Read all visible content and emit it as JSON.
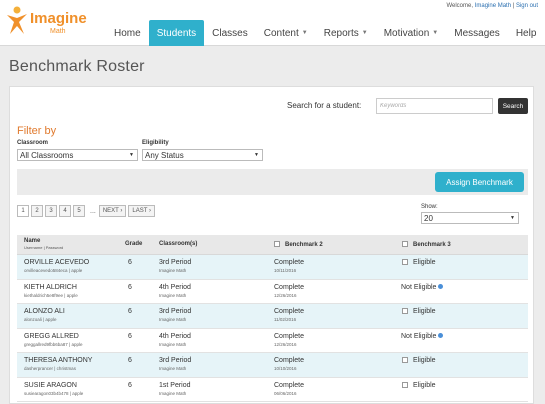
{
  "brand": {
    "name": "Imagine",
    "sub": "Math"
  },
  "top_links": {
    "welcome": "Welcome,",
    "user": "Imagine Math",
    "separator": "|",
    "signout": "Sign out"
  },
  "nav": [
    "Home",
    "Students",
    "Classes",
    "Content",
    "Reports",
    "Motivation",
    "Messages",
    "Help"
  ],
  "nav_active": "Students",
  "page_title": "Benchmark Roster",
  "search": {
    "label": "Search for a student:",
    "placeholder": "Keywords",
    "button": "Search"
  },
  "filter": {
    "title": "Filter by",
    "classroom_label": "Classroom",
    "classroom_value": "All Classrooms",
    "eligibility_label": "Eligibility",
    "eligibility_value": "Any Status"
  },
  "assign_button": "Assign Benchmark",
  "pagination": {
    "pages": [
      "1",
      "2",
      "3",
      "4",
      "5"
    ],
    "ellipsis": "...",
    "next": "NEXT ›",
    "last": "LAST ›"
  },
  "show": {
    "label": "Show:",
    "value": "20"
  },
  "table": {
    "headers": {
      "name": "Name",
      "name_sub": "Username | Password",
      "grade": "Grade",
      "classroom": "Classroom(s)",
      "benchmark2": "Benchmark 2",
      "benchmark3": "Benchmark 3"
    },
    "rows": [
      {
        "name": "ORVILLE ACEVEDO",
        "login": "orvilleacevedo584eca | apple",
        "grade": "6",
        "period": "3rd Period",
        "school": "Imagine Math",
        "b2": "Complete",
        "b2_date": "10/11/2016",
        "b3": "Eligible",
        "b3_checkbox": true
      },
      {
        "name": "KIETH ALDRICH",
        "login": "kiethaldrich5e8f9ee | apple",
        "grade": "6",
        "period": "4th Period",
        "school": "Imagine Math",
        "b2": "Complete",
        "b2_date": "12/26/2016",
        "b3": "Not Eligible",
        "b3_checkbox": false
      },
      {
        "name": "ALONZO ALI",
        "login": "alonzoali | apple",
        "grade": "6",
        "period": "3rd Period",
        "school": "Imagine Math",
        "b2": "Complete",
        "b2_date": "11/02/2016",
        "b3": "Eligible",
        "b3_checkbox": true
      },
      {
        "name": "GREGG ALLRED",
        "login": "greggallred9fbb6ba87 | apple",
        "grade": "6",
        "period": "4th Period",
        "school": "Imagine Math",
        "b2": "Complete",
        "b2_date": "12/26/2016",
        "b3": "Not Eligible",
        "b3_checkbox": false
      },
      {
        "name": "THERESA ANTHONY",
        "login": "dasherprancer | christmas",
        "grade": "6",
        "period": "3rd Period",
        "school": "Imagine Math",
        "b2": "Complete",
        "b2_date": "10/10/2016",
        "b3": "Eligible",
        "b3_checkbox": true
      },
      {
        "name": "SUSIE ARAGON",
        "login": "susiearagon03b4b478 | apple",
        "grade": "6",
        "period": "1st Period",
        "school": "Imagine Math",
        "b2": "Complete",
        "b2_date": "06/06/2016",
        "b3": "Eligible",
        "b3_checkbox": true
      }
    ]
  },
  "colors": {
    "accent": "#2fb0cc",
    "orange": "#e07a2e",
    "row_alt": "#e6f4f8"
  }
}
